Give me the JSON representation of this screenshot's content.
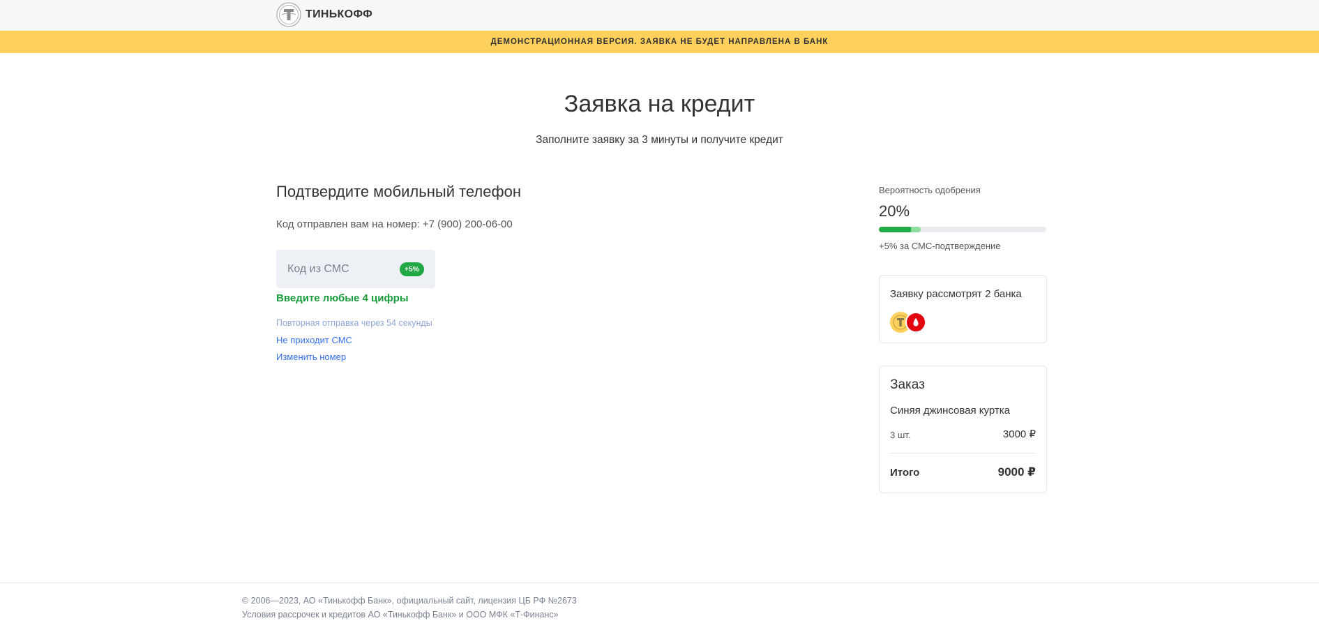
{
  "header": {
    "brand": "ТИНЬКОФФ"
  },
  "banner": {
    "text": "ДЕМОНСТРАЦИОННАЯ ВЕРСИЯ. ЗАЯВКА НЕ БУДЕТ НАПРАВЛЕНА В БАНК"
  },
  "page": {
    "title": "Заявка на кредит",
    "subtitle": "Заполните заявку за 3 минуты и получите кредит"
  },
  "confirm": {
    "title": "Подтвердите мобильный телефон",
    "sent_info": "Код отправлен вам на номер: +7 (900) 200-06-00",
    "input_placeholder": "Код из СМС",
    "input_value": "",
    "bonus_badge": "+5%",
    "hint": "Введите любые 4 цифры",
    "resend_timer": "Повторная отправка через 54 секунды",
    "no_sms_link": "Не приходит СМС",
    "change_number_link": "Изменить номер"
  },
  "approval": {
    "label": "Вероятность одобрения",
    "value": "20%",
    "progress_percent": 20,
    "bonus_percent": 5,
    "bonus_note": "+5% за СМС-подтверждение"
  },
  "banks": {
    "title": "Заявку рассмотрят 2 банка",
    "items": [
      {
        "icon": "tinkoff-logo-icon",
        "color": "#ffd15c"
      },
      {
        "icon": "mts-bank-logo-icon",
        "color": "#e30611"
      }
    ]
  },
  "order": {
    "title": "Заказ",
    "item_name": "Синяя джинсовая куртка",
    "quantity": "3 шт.",
    "price": "3000 ₽",
    "total_label": "Итого",
    "total_value": "9000 ₽"
  },
  "footer": {
    "copyright": "© 2006—2023, АО «Тинькофф Банк», официальный сайт, лицензия ЦБ РФ №2673",
    "terms": "Условия рассрочек и кредитов АО «Тинькофф Банк» и ООО МФК «Т-Финанс»"
  },
  "colors": {
    "banner": "#ffd15c",
    "accent_green": "#1fa843",
    "link_blue": "#336fee",
    "input_bg": "#edf0f5"
  }
}
